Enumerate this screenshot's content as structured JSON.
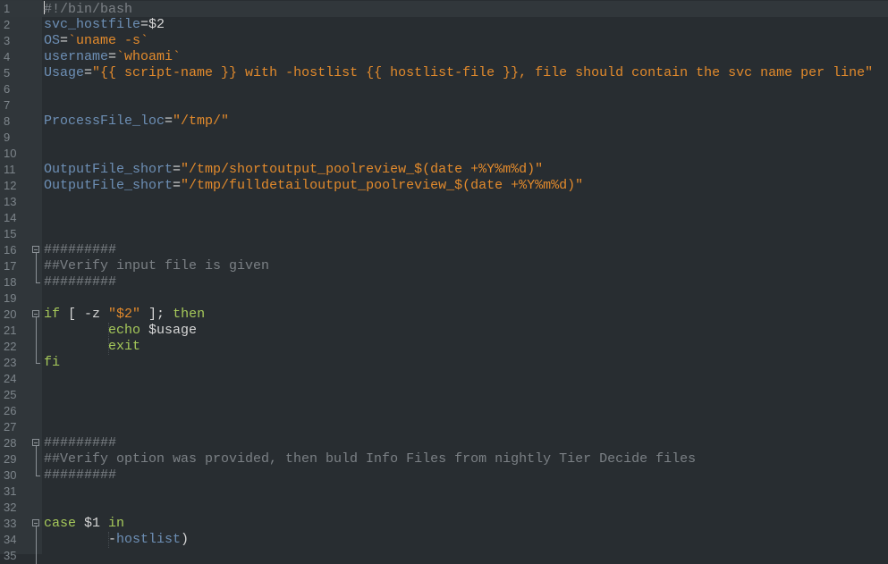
{
  "editor": {
    "language": "bash",
    "current_line": 1,
    "colors": {
      "background": "#282d31",
      "gutter": "#30363a",
      "variable": "#6d8fb5",
      "string": "#e28a2c",
      "keyword": "#a6c95a",
      "comment": "#7b8085",
      "text": "#d6d6d6"
    },
    "lines": [
      {
        "n": "1",
        "tokens": [
          [
            "#!/bin/bash",
            "cm"
          ]
        ]
      },
      {
        "n": "2",
        "tokens": [
          [
            "svc_hostfile",
            "var"
          ],
          [
            "=$2",
            "op"
          ]
        ]
      },
      {
        "n": "3",
        "tokens": [
          [
            "OS",
            "var"
          ],
          [
            "=",
            "op"
          ],
          [
            "`uname -s`",
            "str"
          ]
        ]
      },
      {
        "n": "4",
        "tokens": [
          [
            "username",
            "var"
          ],
          [
            "=",
            "op"
          ],
          [
            "`whoami`",
            "str"
          ]
        ]
      },
      {
        "n": "5",
        "tokens": [
          [
            "Usage",
            "var"
          ],
          [
            "=",
            "op"
          ],
          [
            "\"{{ script-name }} with -hostlist {{ hostlist-file }}, file should contain the svc name per line\"",
            "str"
          ]
        ]
      },
      {
        "n": "6",
        "tokens": []
      },
      {
        "n": "7",
        "tokens": []
      },
      {
        "n": "8",
        "tokens": [
          [
            "ProcessFile_loc",
            "var"
          ],
          [
            "=",
            "op"
          ],
          [
            "\"/tmp/\"",
            "str"
          ]
        ]
      },
      {
        "n": "9",
        "tokens": []
      },
      {
        "n": "10",
        "tokens": []
      },
      {
        "n": "11",
        "tokens": [
          [
            "OutputFile_short",
            "var"
          ],
          [
            "=",
            "op"
          ],
          [
            "\"/tmp/shortoutput_poolreview_$(date +%Y%m%d)\"",
            "str"
          ]
        ]
      },
      {
        "n": "12",
        "tokens": [
          [
            "OutputFile_short",
            "var"
          ],
          [
            "=",
            "op"
          ],
          [
            "\"/tmp/fulldetailoutput_poolreview_$(date +%Y%m%d)\"",
            "str"
          ]
        ]
      },
      {
        "n": "13",
        "tokens": []
      },
      {
        "n": "14",
        "tokens": []
      },
      {
        "n": "15",
        "tokens": []
      },
      {
        "n": "16",
        "fold": "start",
        "tokens": [
          [
            "#########",
            "cm"
          ]
        ]
      },
      {
        "n": "17",
        "fold": "mid",
        "tokens": [
          [
            "##Verify input file is given",
            "cm"
          ]
        ]
      },
      {
        "n": "18",
        "fold": "end",
        "tokens": [
          [
            "#########",
            "cm"
          ]
        ]
      },
      {
        "n": "19",
        "tokens": []
      },
      {
        "n": "20",
        "fold": "start",
        "tokens": [
          [
            "if",
            "kw"
          ],
          [
            " [ -z ",
            "op"
          ],
          [
            "\"$2\"",
            "str"
          ],
          [
            " ]; ",
            "op"
          ],
          [
            "then",
            "kw"
          ]
        ]
      },
      {
        "n": "21",
        "fold": "mid",
        "guide": true,
        "tokens": [
          [
            "        ",
            "op"
          ],
          [
            "echo",
            "kw"
          ],
          [
            " $usage",
            "op"
          ]
        ]
      },
      {
        "n": "22",
        "fold": "mid",
        "guide": true,
        "tokens": [
          [
            "        ",
            "op"
          ],
          [
            "exit",
            "kw"
          ]
        ]
      },
      {
        "n": "23",
        "fold": "end",
        "tokens": [
          [
            "fi",
            "kw"
          ]
        ]
      },
      {
        "n": "24",
        "tokens": []
      },
      {
        "n": "25",
        "tokens": []
      },
      {
        "n": "26",
        "tokens": []
      },
      {
        "n": "27",
        "tokens": []
      },
      {
        "n": "28",
        "fold": "start",
        "tokens": [
          [
            "#########",
            "cm"
          ]
        ]
      },
      {
        "n": "29",
        "fold": "mid",
        "tokens": [
          [
            "##Verify option was provided, then buld Info Files from nightly Tier Decide files",
            "cm"
          ]
        ]
      },
      {
        "n": "30",
        "fold": "end",
        "tokens": [
          [
            "#########",
            "cm"
          ]
        ]
      },
      {
        "n": "31",
        "tokens": []
      },
      {
        "n": "32",
        "tokens": []
      },
      {
        "n": "33",
        "fold": "start",
        "tokens": [
          [
            "case",
            "kw"
          ],
          [
            " $1 ",
            "op"
          ],
          [
            "in",
            "kw"
          ]
        ]
      },
      {
        "n": "34",
        "fold": "mid",
        "guide": true,
        "tokens": [
          [
            "        ",
            "op"
          ],
          [
            "-",
            "op"
          ],
          [
            "hostlist",
            "var"
          ],
          [
            ")",
            "op"
          ]
        ]
      },
      {
        "n": "35",
        "fold": "mid",
        "tokens": []
      }
    ]
  }
}
